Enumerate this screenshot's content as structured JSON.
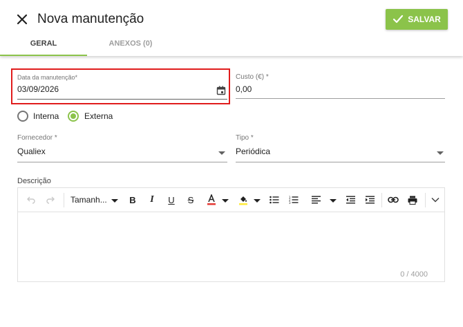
{
  "header": {
    "title": "Nova manutenção",
    "save_label": "SALVAR",
    "accent_color": "#8bc34a"
  },
  "tabs": [
    {
      "label": "GERAL",
      "active": true
    },
    {
      "label": "ANEXOS (0)",
      "active": false
    }
  ],
  "form": {
    "date": {
      "label": "Data da manutenção*",
      "value": "03/09/2026"
    },
    "cost": {
      "label": "Custo (€) *",
      "value": "0,00"
    },
    "type_radio": {
      "options": [
        {
          "label": "Interna",
          "checked": false
        },
        {
          "label": "Externa",
          "checked": true
        }
      ]
    },
    "supplier": {
      "label": "Fornecedor *",
      "value": "Qualiex"
    },
    "kind": {
      "label": "Tipo *",
      "value": "Periódica"
    },
    "description": {
      "label": "Descrição",
      "font_size_label": "Tamanh...",
      "counter": "0 / 4000"
    }
  }
}
